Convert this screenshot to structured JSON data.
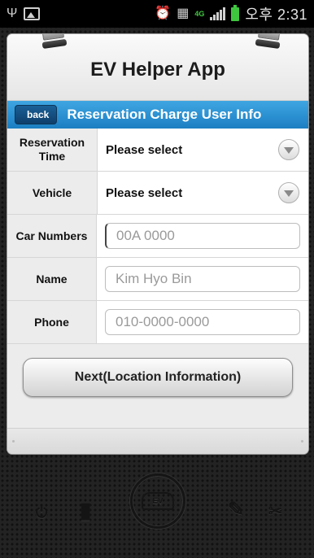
{
  "status_bar": {
    "usb_icon": "usb-icon",
    "time": "오후 2:31",
    "network_label": "4G"
  },
  "app": {
    "title": "EV Helper App"
  },
  "nav": {
    "back_label": "back",
    "title": "Reservation Charge User Info"
  },
  "form": {
    "rows": [
      {
        "label": "Reservation Time",
        "value": "Please select",
        "type": "select"
      },
      {
        "label": "Vehicle",
        "value": "Please select",
        "type": "select"
      },
      {
        "label": "Car Numbers",
        "placeholder": "00A 0000",
        "type": "input"
      },
      {
        "label": "Name",
        "placeholder": "Kim Hyo Bin",
        "type": "input"
      },
      {
        "label": "Phone",
        "placeholder": "010-0000-0000",
        "type": "input"
      }
    ]
  },
  "actions": {
    "next_label": "Next(Location Information)"
  },
  "deco": {
    "ev_label": "EV"
  },
  "colors": {
    "nav_blue": "#1b7ec2",
    "battery_green": "#3fc63f"
  }
}
